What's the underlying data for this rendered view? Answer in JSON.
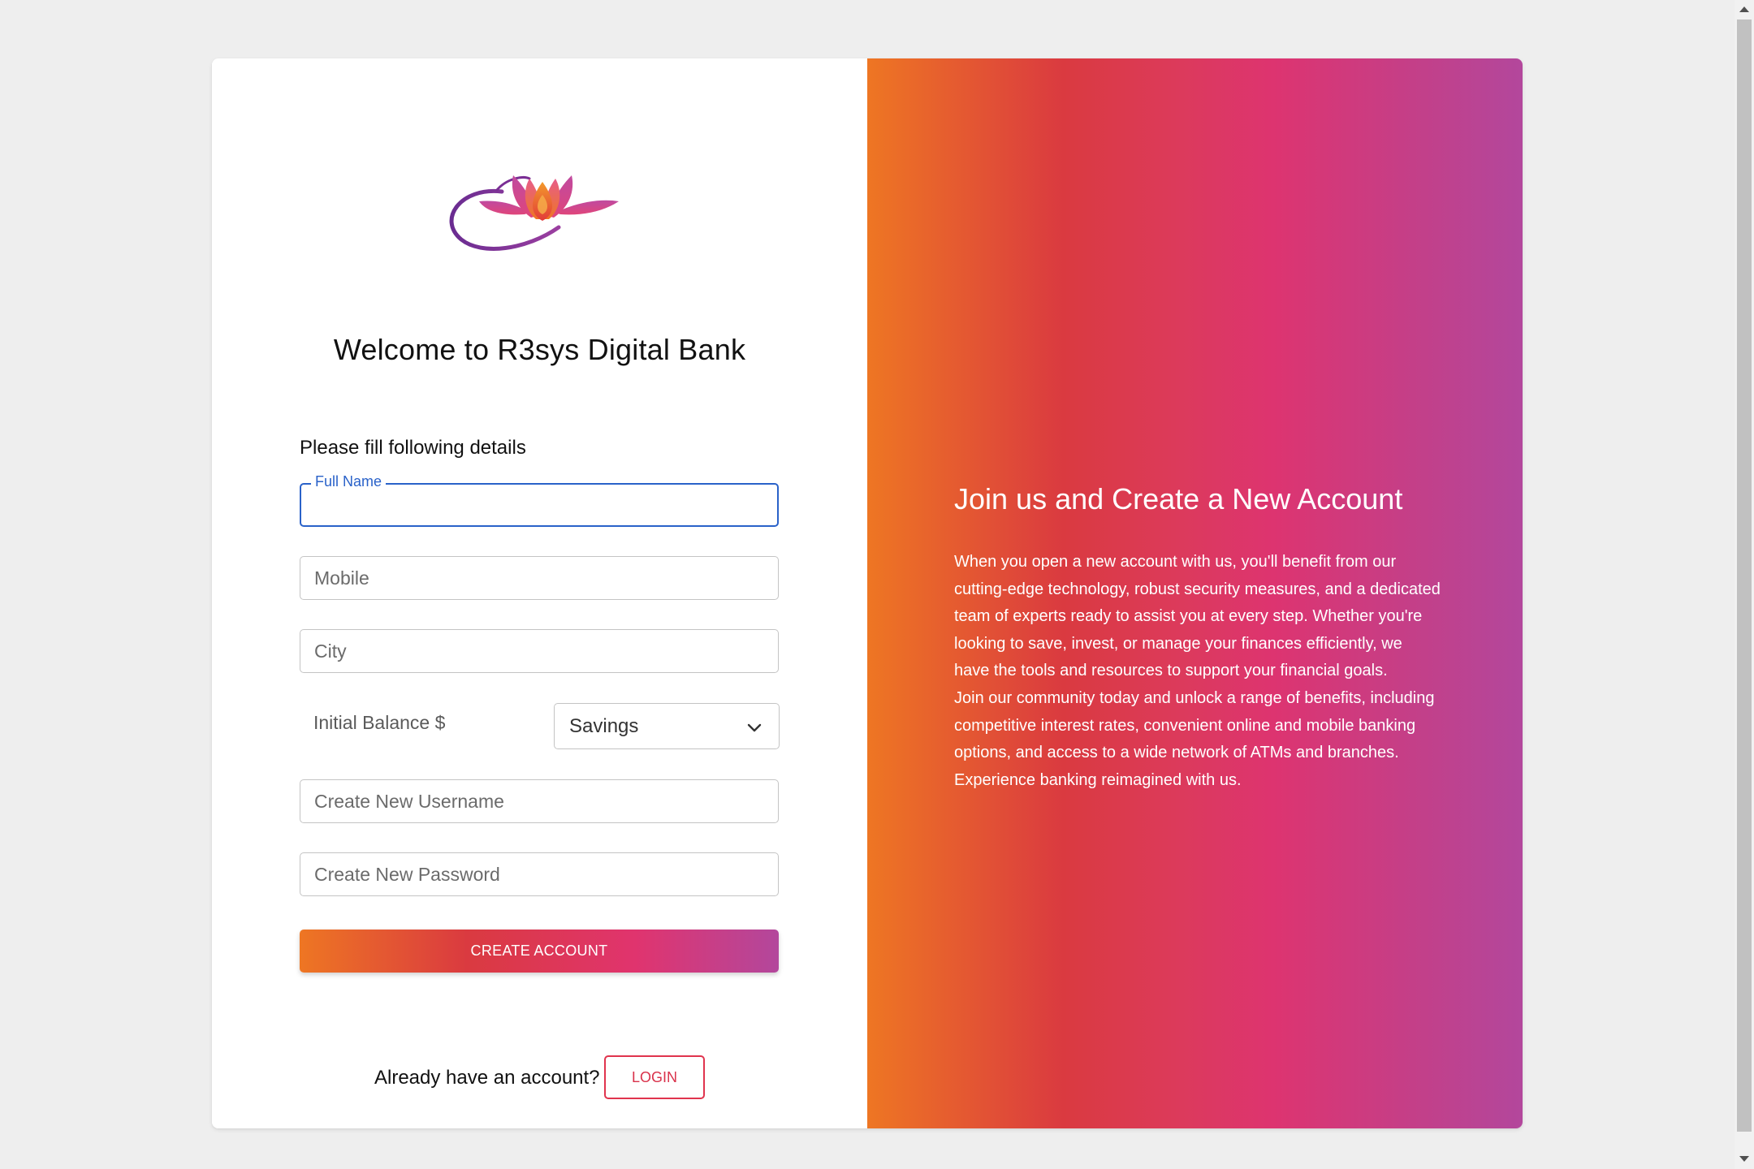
{
  "brand": {
    "logo": "lotus-logo",
    "welcome_title": "Welcome to R3sys Digital Bank"
  },
  "form": {
    "intro": "Please fill following details",
    "full_name": {
      "label": "Full Name",
      "value": ""
    },
    "mobile": {
      "placeholder": "Mobile",
      "value": ""
    },
    "city": {
      "placeholder": "City",
      "value": ""
    },
    "initial_balance": {
      "placeholder": "Initial Balance $",
      "value": ""
    },
    "account_type": {
      "selected": "Savings"
    },
    "username": {
      "placeholder": "Create New Username",
      "value": ""
    },
    "password": {
      "placeholder": "Create New Password",
      "value": ""
    },
    "submit_label": "CREATE ACCOUNT"
  },
  "login_prompt": {
    "text": "Already have an account?",
    "button_label": "LOGIN"
  },
  "promo": {
    "title": "Join us and Create a New Account",
    "paragraphs": [
      "When you open a new account with us, you'll benefit from our cutting-edge technology, robust security measures, and a dedicated team of experts ready to assist you at every step. Whether you're looking to save, invest, or manage your finances efficiently, we have the tools and resources to support your financial goals.",
      "Join our community today and unlock a range of benefits, including competitive interest rates, convenient online and mobile banking options, and access to a wide network of ATMs and branches. Experience banking reimagined with us."
    ]
  },
  "colors": {
    "gradient": [
      "#ee7623",
      "#da3a40",
      "#dd3470",
      "#b3479c"
    ],
    "focus_blue": "#2a62c9",
    "login_border": "#e0344e"
  },
  "icons": {
    "select": "chevron-down-icon"
  }
}
